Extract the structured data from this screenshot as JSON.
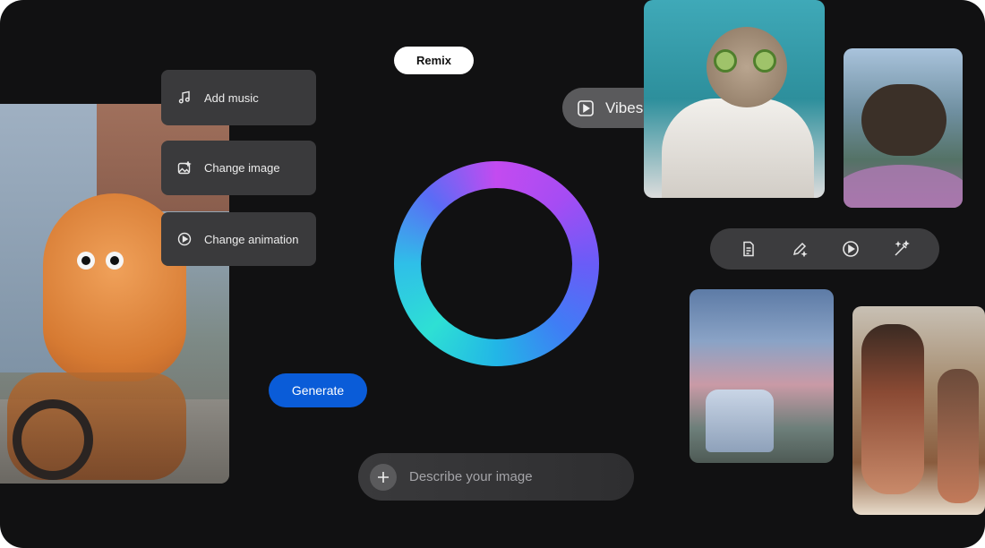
{
  "buttons": {
    "remix": "Remix",
    "vibes": "Vibes",
    "generate": "Generate"
  },
  "options": [
    {
      "label": "Add music",
      "icon": "music-note-icon"
    },
    {
      "label": "Change image",
      "icon": "image-edit-icon"
    },
    {
      "label": "Change animation",
      "icon": "play-circle-icon"
    }
  ],
  "toolbar": {
    "tools": [
      "document-icon",
      "pencil-icon",
      "play-icon",
      "magic-wand-icon"
    ]
  },
  "prompt": {
    "placeholder": "Describe your image"
  },
  "colors": {
    "generate": "#0a5cd8",
    "background": "#111112"
  }
}
